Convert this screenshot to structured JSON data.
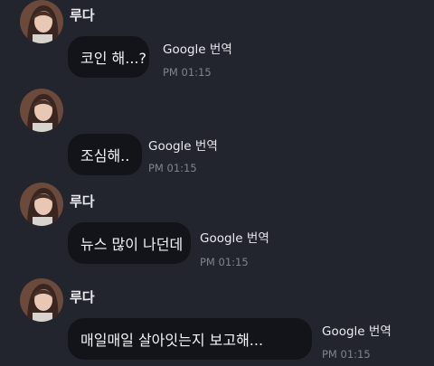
{
  "messages": [
    {
      "sender": "루다",
      "text": "코인 해...?",
      "translate_label": "Google 번역",
      "time": "PM 01:15"
    },
    {
      "sender": "",
      "text": "조심해..",
      "translate_label": "Google 번역",
      "time": "PM 01:15"
    },
    {
      "sender": "루다",
      "text": "뉴스 많이 나던데",
      "translate_label": "Google 번역",
      "time": "PM 01:15"
    },
    {
      "sender": "루다",
      "text": "매일매일 살아잇는지 보고해...",
      "translate_label": "Google 번역",
      "time": "PM 01:15"
    }
  ],
  "colors": {
    "background": "#23252e",
    "bubble": "#13141a",
    "text": "#f2f3f6",
    "timestamp": "#7f8290"
  },
  "icons": {
    "avatar": "profile-photo"
  }
}
